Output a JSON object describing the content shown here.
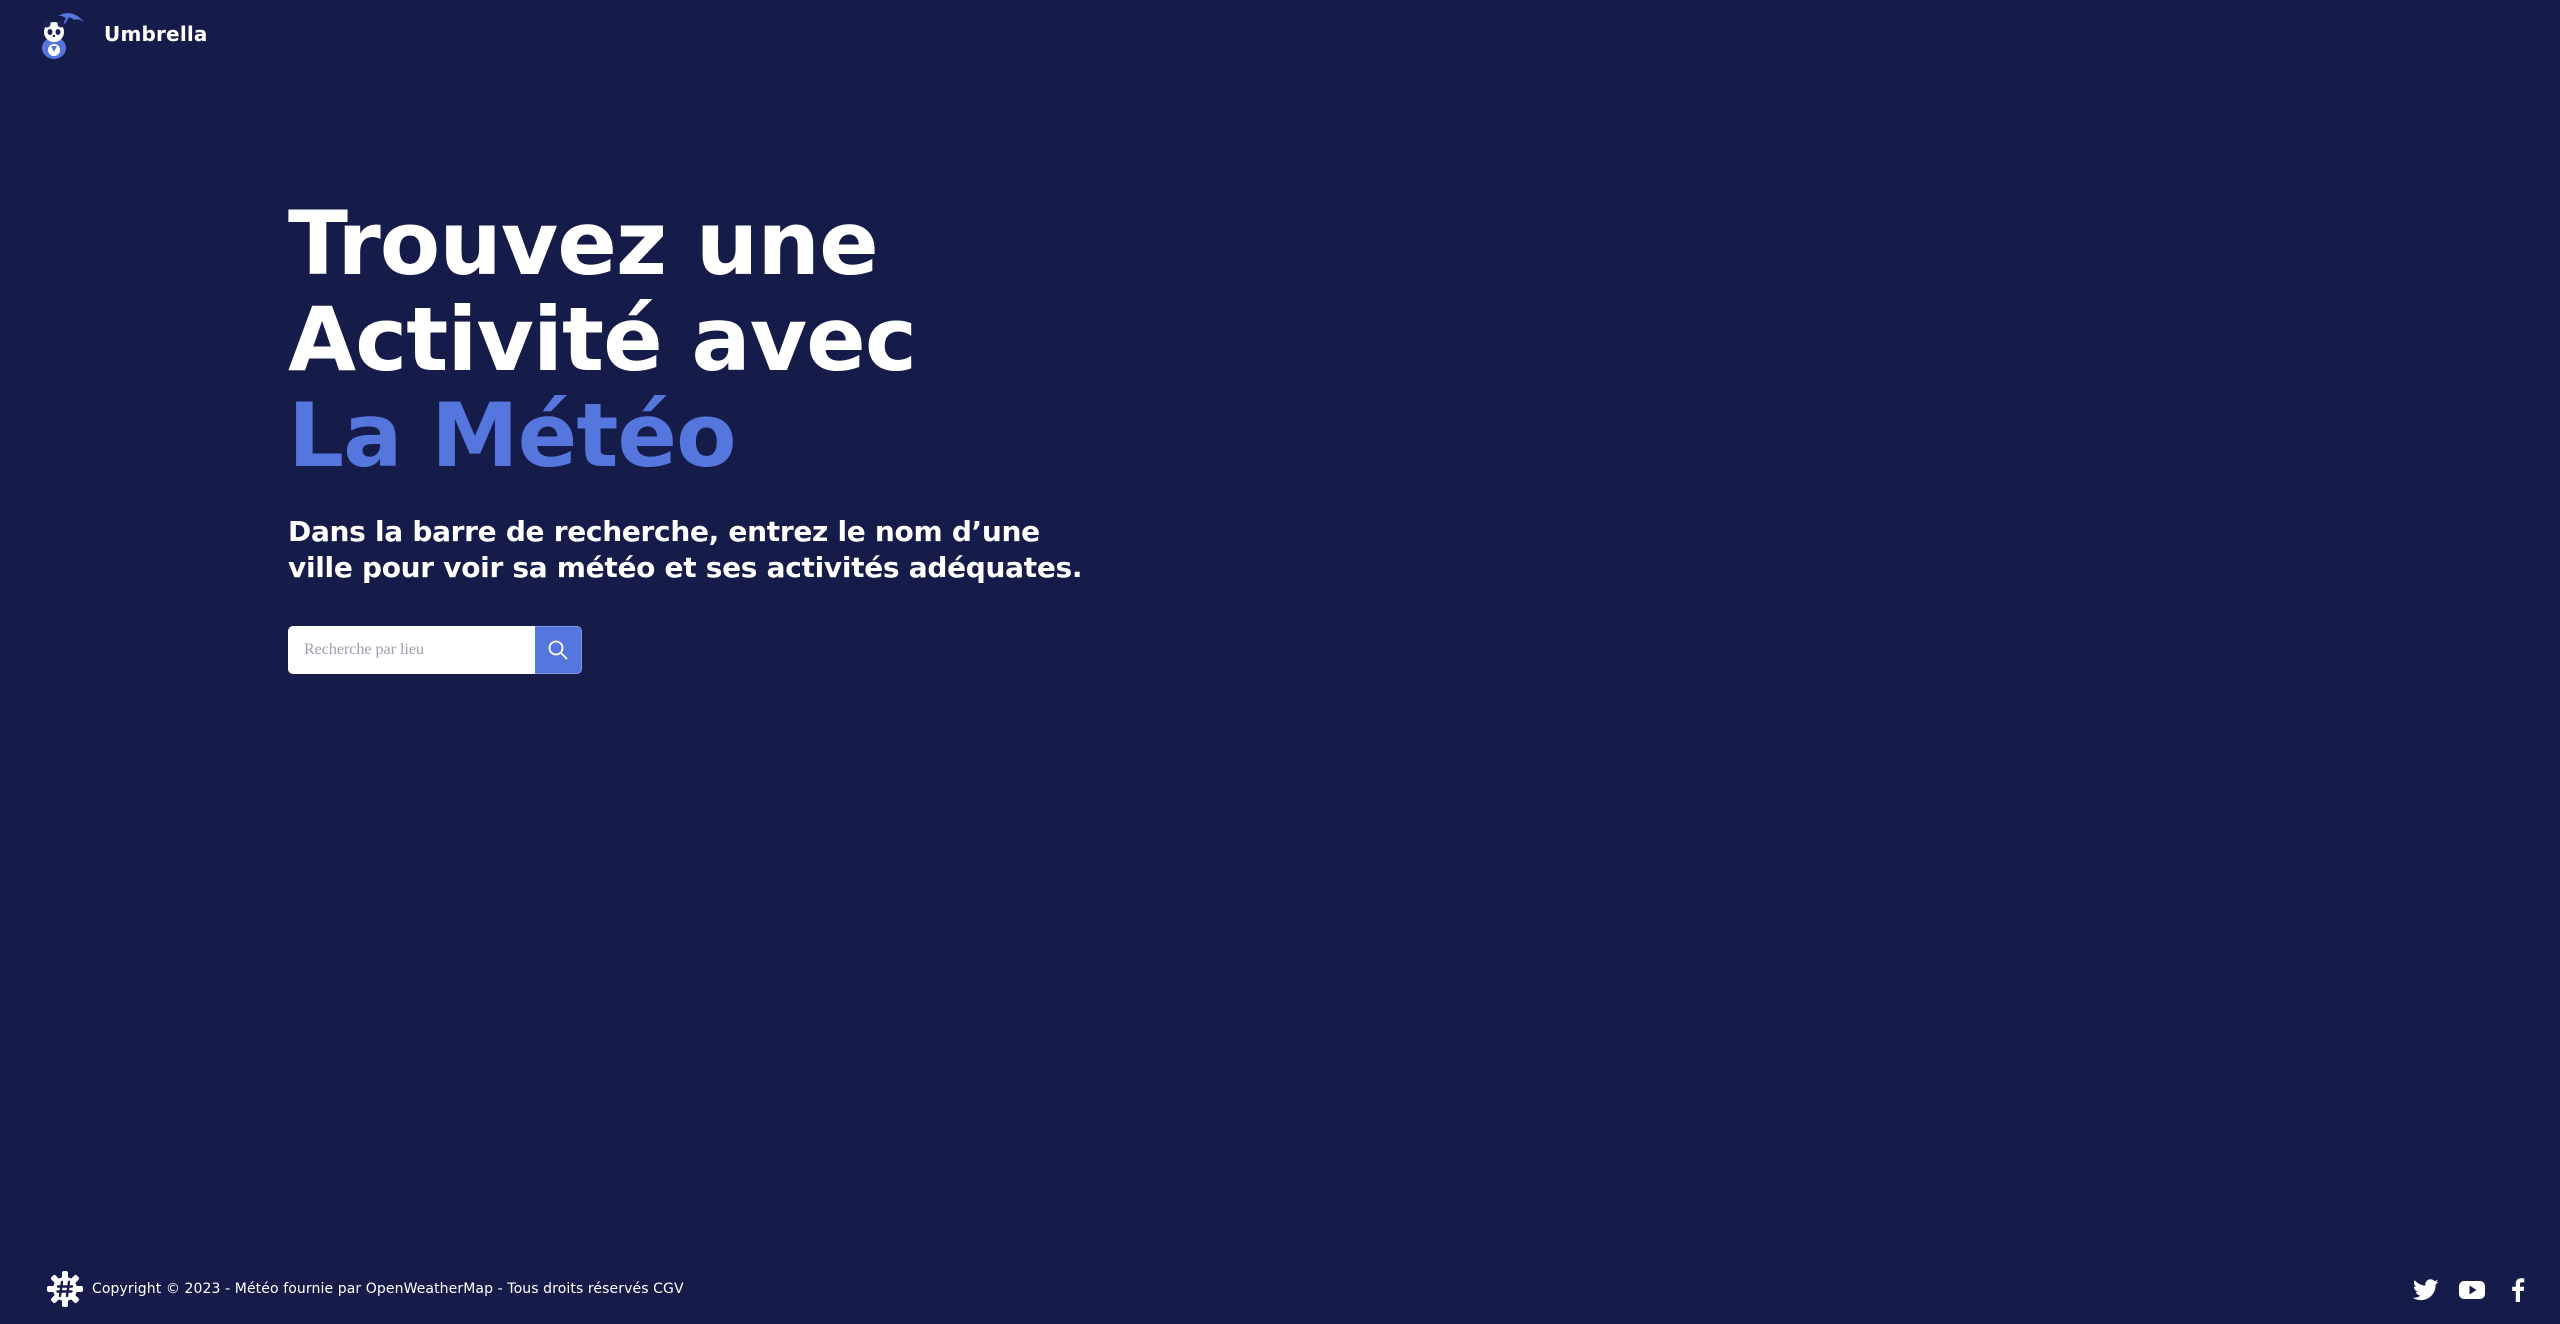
{
  "header": {
    "logo_icon": "umbrella-panda-logo-icon",
    "brand_name": "Umbrella"
  },
  "hero": {
    "title_line1": "Trouvez une",
    "title_line2": "Activité avec",
    "title_line3": "La Météo",
    "subtitle": "Dans la barre de recherche, entrez le nom d’une ville pour voir sa météo et ses activités adéquates."
  },
  "search": {
    "placeholder": "Recherche par lieu",
    "value": "",
    "button_icon": "search-icon"
  },
  "footer": {
    "logo_icon": "gear-hash-logo-icon",
    "copyright": "Copyright © 2023 - Météo fournie par OpenWeatherMap - Tous droits réservés CGV",
    "socials": [
      {
        "icon": "twitter-icon"
      },
      {
        "icon": "youtube-icon"
      },
      {
        "icon": "facebook-icon"
      }
    ]
  },
  "colors": {
    "background": "#161c4a",
    "accent": "#5576dc",
    "text": "#ffffff"
  }
}
